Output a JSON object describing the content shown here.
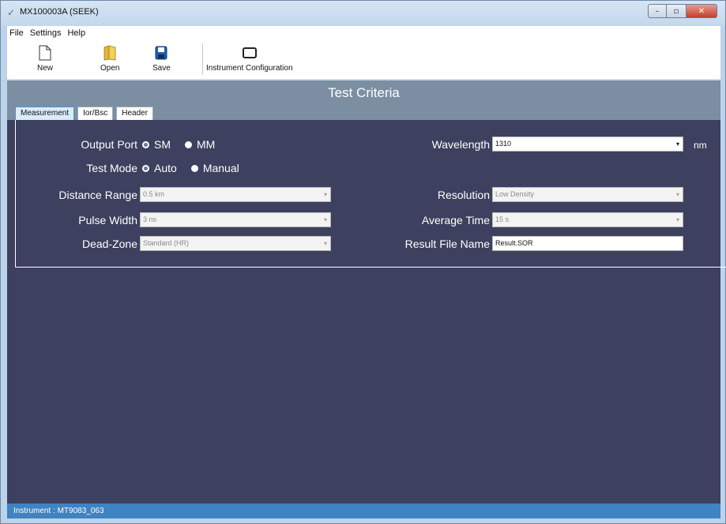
{
  "window": {
    "title": "MX100003A (SEEK)",
    "controls": {
      "minimize": "–",
      "maximize": "▫",
      "close": "✕"
    }
  },
  "menu": [
    "File",
    "Settings",
    "Help"
  ],
  "toolbar": {
    "new_label": "New",
    "open_label": "Open",
    "save_label": "Save",
    "instrument_config_label": "Instrument Configuration"
  },
  "section": {
    "title": "Test Criteria",
    "tabs": [
      "Measurement",
      "Ior/Bsc",
      "Header"
    ],
    "active_tab": "Measurement"
  },
  "form": {
    "output_port": {
      "label": "Output Port",
      "options": [
        "SM",
        "MM"
      ],
      "selected": "SM"
    },
    "test_mode": {
      "label": "Test Mode",
      "options": [
        "Auto",
        "Manual"
      ],
      "selected": "Auto"
    },
    "distance_range": {
      "label": "Distance Range",
      "value": "0.5 km"
    },
    "pulse_width": {
      "label": "Pulse Width",
      "value": "3 ns"
    },
    "dead_zone": {
      "label": "Dead-Zone",
      "value": "Standard (HR)"
    },
    "wavelength": {
      "label": "Wavelength",
      "value": "1310",
      "unit": "nm"
    },
    "resolution": {
      "label": "Resolution",
      "value": "Low Density"
    },
    "average_time": {
      "label": "Average Time",
      "value": "15 s"
    },
    "result_file_name": {
      "label": "Result File Name",
      "value": "Result.SOR"
    }
  },
  "status": {
    "text": "Instrument : MT9083_063"
  },
  "colors": {
    "header_band": "#7c8fa2",
    "main_bg": "#3d405e",
    "statusbar": "#3e83c4",
    "active_tab": "#d9ecf9"
  }
}
